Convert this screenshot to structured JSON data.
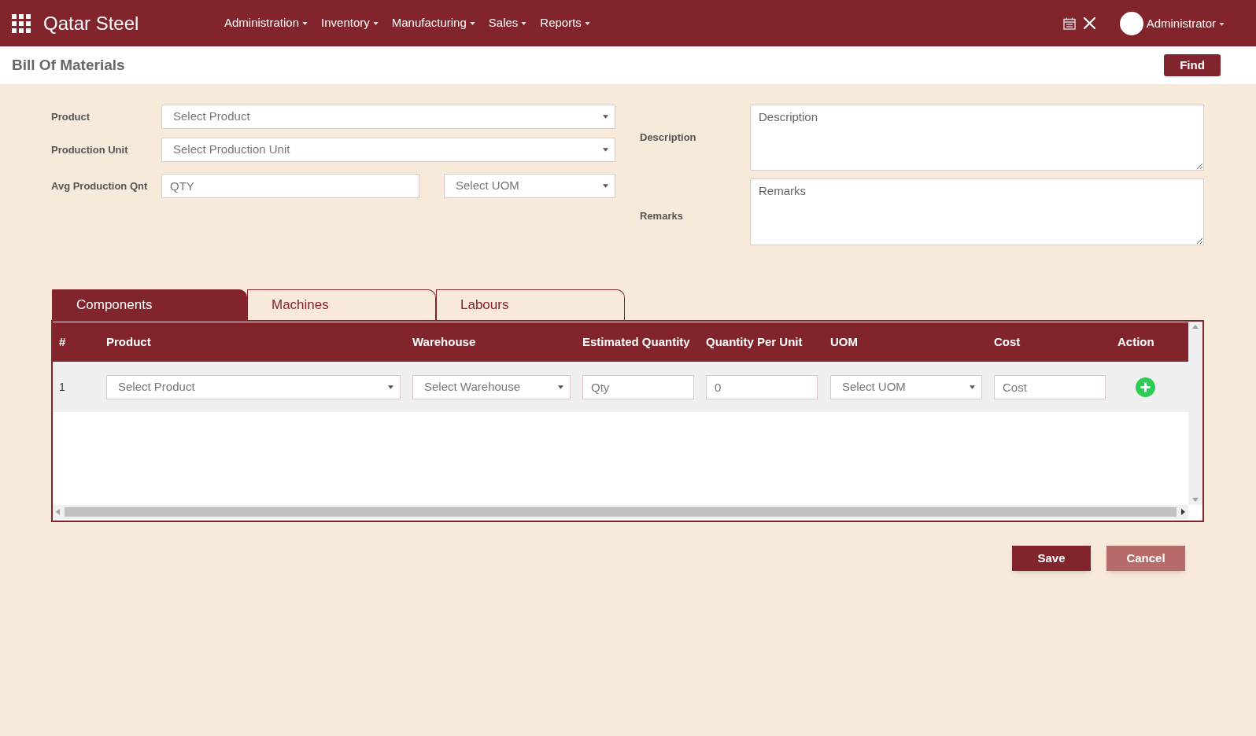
{
  "app": {
    "name": "Qatar Steel"
  },
  "nav": [
    {
      "label": "Administration"
    },
    {
      "label": "Inventory"
    },
    {
      "label": "Manufacturing"
    },
    {
      "label": "Sales"
    },
    {
      "label": "Reports"
    }
  ],
  "user": {
    "name": "Administrator"
  },
  "page": {
    "title": "Bill Of Materials",
    "find_button": "Find"
  },
  "form": {
    "product": {
      "label": "Product",
      "placeholder": "Select Product"
    },
    "production_unit": {
      "label": "Production Unit",
      "placeholder": "Select Production Unit"
    },
    "avg_production": {
      "label": "Avg Production Qnt",
      "placeholder": "QTY",
      "uom_placeholder": "Select UOM"
    },
    "description": {
      "label": "Description",
      "placeholder": "Description"
    },
    "remarks": {
      "label": "Remarks",
      "placeholder": "Remarks"
    }
  },
  "tabs": [
    {
      "label": "Components",
      "selected": true
    },
    {
      "label": "Machines",
      "selected": false
    },
    {
      "label": "Labours",
      "selected": false
    }
  ],
  "table": {
    "columns": [
      "#",
      "Product",
      "Warehouse",
      "Estimated Quantity",
      "Quantity Per Unit",
      "UOM",
      "Cost",
      "Action"
    ],
    "rows": [
      {
        "cells": [
          {
            "kind": "text",
            "text": "1"
          },
          {
            "kind": "select",
            "placeholder": "Select Product"
          },
          {
            "kind": "select",
            "placeholder": "Select Warehouse"
          },
          {
            "kind": "input",
            "placeholder": "Qty"
          },
          {
            "kind": "input",
            "value": "0"
          },
          {
            "kind": "select",
            "placeholder": "Select UOM"
          },
          {
            "kind": "input",
            "placeholder": "Cost"
          },
          {
            "kind": "action"
          }
        ]
      }
    ]
  },
  "buttons": [
    {
      "label": "Save",
      "kind": "primary"
    },
    {
      "label": "Cancel",
      "kind": "secondary"
    }
  ]
}
